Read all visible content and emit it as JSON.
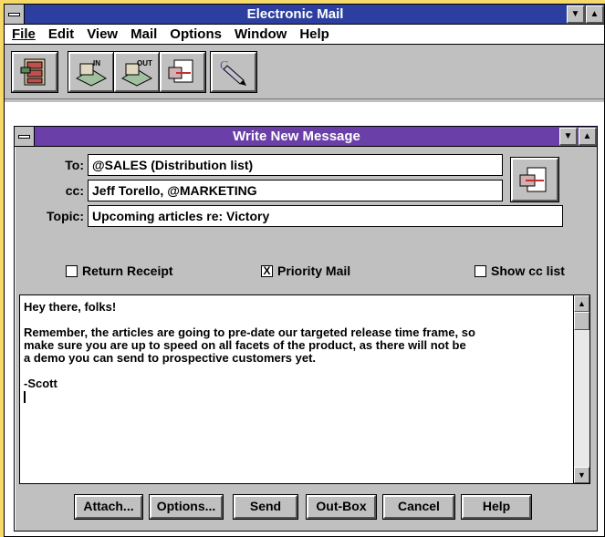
{
  "app": {
    "title": "Electronic Mail",
    "menu": [
      "File",
      "Edit",
      "View",
      "Mail",
      "Options",
      "Window",
      "Help"
    ],
    "toolbar": [
      {
        "icon": "file-cabinet-icon"
      },
      {
        "icon": "inbox-icon",
        "label": "IN"
      },
      {
        "icon": "outbox-icon",
        "label": "OUT"
      },
      {
        "icon": "compose-icon"
      },
      {
        "icon": "pen-icon",
        "label": "C"
      }
    ]
  },
  "compose": {
    "title": "Write New Message",
    "to_label": "To:",
    "to_value": "@SALES (Distribution list)",
    "cc_label": "cc:",
    "cc_value": "Jeff Torello, @MARKETING",
    "topic_label": "Topic:",
    "topic_value": "Upcoming articles re: Victory",
    "return_receipt": "Return Receipt",
    "priority_mail": "Priority Mail",
    "show_cc": "Show cc list",
    "priority_checked": "X",
    "body": "Hey there, folks!\n\nRemember, the articles are going to pre-date our targeted release time frame, so\nmake sure you are up to speed on all facets of the product, as there will not be\na demo you can send to prospective customers yet.\n\n-Scott",
    "buttons": {
      "attach": "Attach...",
      "options": "Options...",
      "send": "Send",
      "outbox": "Out-Box",
      "cancel": "Cancel",
      "help": "Help"
    }
  },
  "colors": {
    "app_titlebar": "#2c3fa0",
    "compose_titlebar": "#6a3fa8",
    "background": "#f7d96a"
  }
}
